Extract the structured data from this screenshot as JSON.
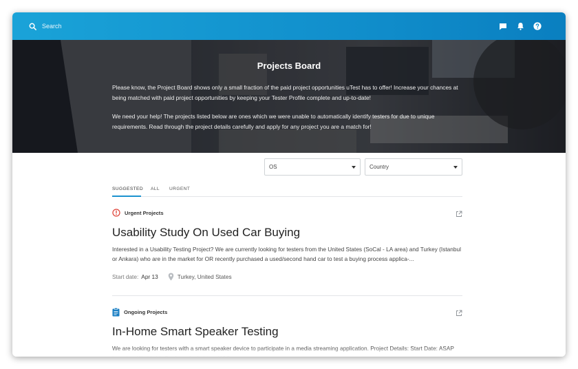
{
  "header": {
    "search_label": "Search",
    "icons": [
      "search-icon",
      "chat-icon",
      "bell-icon",
      "help-icon"
    ]
  },
  "hero": {
    "title": "Projects Board",
    "paragraph1": "Please know, the Project Board shows only a small fraction of the paid project opportunities uTest has to offer! Increase your chances at being matched with paid project opportunities by keeping your Tester Profile complete and up-to-date!",
    "paragraph2": "We need your help! The projects listed below are ones which we were unable to automatically identify testers for due to unique requirements. Read through the project details carefully and apply for any project you are a match for!"
  },
  "filters": {
    "os": {
      "selected": "OS"
    },
    "country": {
      "selected": "Country"
    }
  },
  "tabs": [
    {
      "label": "SUGGESTED",
      "active": true
    },
    {
      "label": "ALL",
      "active": false
    },
    {
      "label": "URGENT",
      "active": false
    }
  ],
  "projects": [
    {
      "category": "Urgent Projects",
      "category_icon": "alert-circle-icon",
      "title": "Usability Study On Used Car Buying",
      "description": "Interested in a Usability Testing Project? We are currently looking for testers from the United States (SoCal - LA area) and Turkey (Istanbul or Ankara) who are in the market for OR recently purchased a used/second hand car to test a buying process applica-...",
      "start_label": "Start date:",
      "start_date": "Apr 13",
      "location": "Turkey, United States"
    },
    {
      "category": "Ongoing Projects",
      "category_icon": "clipboard-icon",
      "title": "In-Home Smart Speaker Testing",
      "description": "We are looking for testers with a smart speaker device to participate in a media streaming application. Project Details: Start Date: ASAP Location: Worldwide Devices: Android and iOS..."
    }
  ],
  "colors": {
    "topbar": "#1aa3d8",
    "accent": "#1a92cf",
    "urgent": "#e0483d",
    "ongoing": "#1a7fc4"
  }
}
